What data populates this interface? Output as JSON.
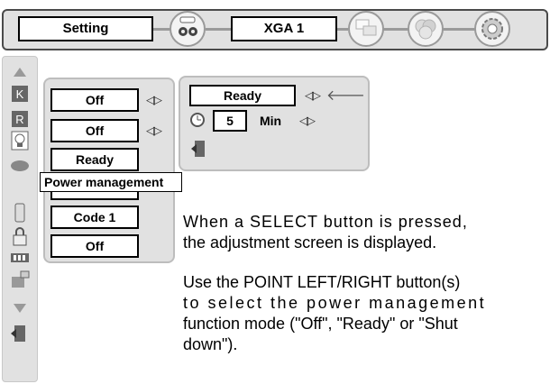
{
  "menu": {
    "title": "Setting",
    "input_resolution": "XGA 1"
  },
  "top_icons": [
    "input-icon",
    "computer-connector-icon",
    "image-select-icon",
    "color-circles-icon",
    "setting-gear-icon"
  ],
  "sidebar": {
    "icons": [
      "scroll-up-arrow-icon",
      "keystone-icon",
      "mirror-icon",
      "lamp-icon",
      "power-management-icon",
      "remote-control-icon",
      "security-lock-icon",
      "fan-icon",
      "filter-icon",
      "scroll-down-arrow-icon",
      "exit-door-icon"
    ]
  },
  "submenu": {
    "values": [
      "Off",
      "Off",
      "Ready",
      "",
      "Code 1",
      "Off"
    ],
    "tooltip": "Power management"
  },
  "power_panel": {
    "mode_value": "Ready",
    "timer_value": "5",
    "timer_unit": "Min"
  },
  "description": {
    "line1": "When a SELECT button is pressed,",
    "line2": "the adjustment screen is displayed.",
    "line3": "Use the POINT LEFT/RIGHT button(s)",
    "line4": "to select the power management",
    "line5": "function mode (\"Off\", \"Ready\" or \"Shut",
    "line6": "down\")."
  }
}
